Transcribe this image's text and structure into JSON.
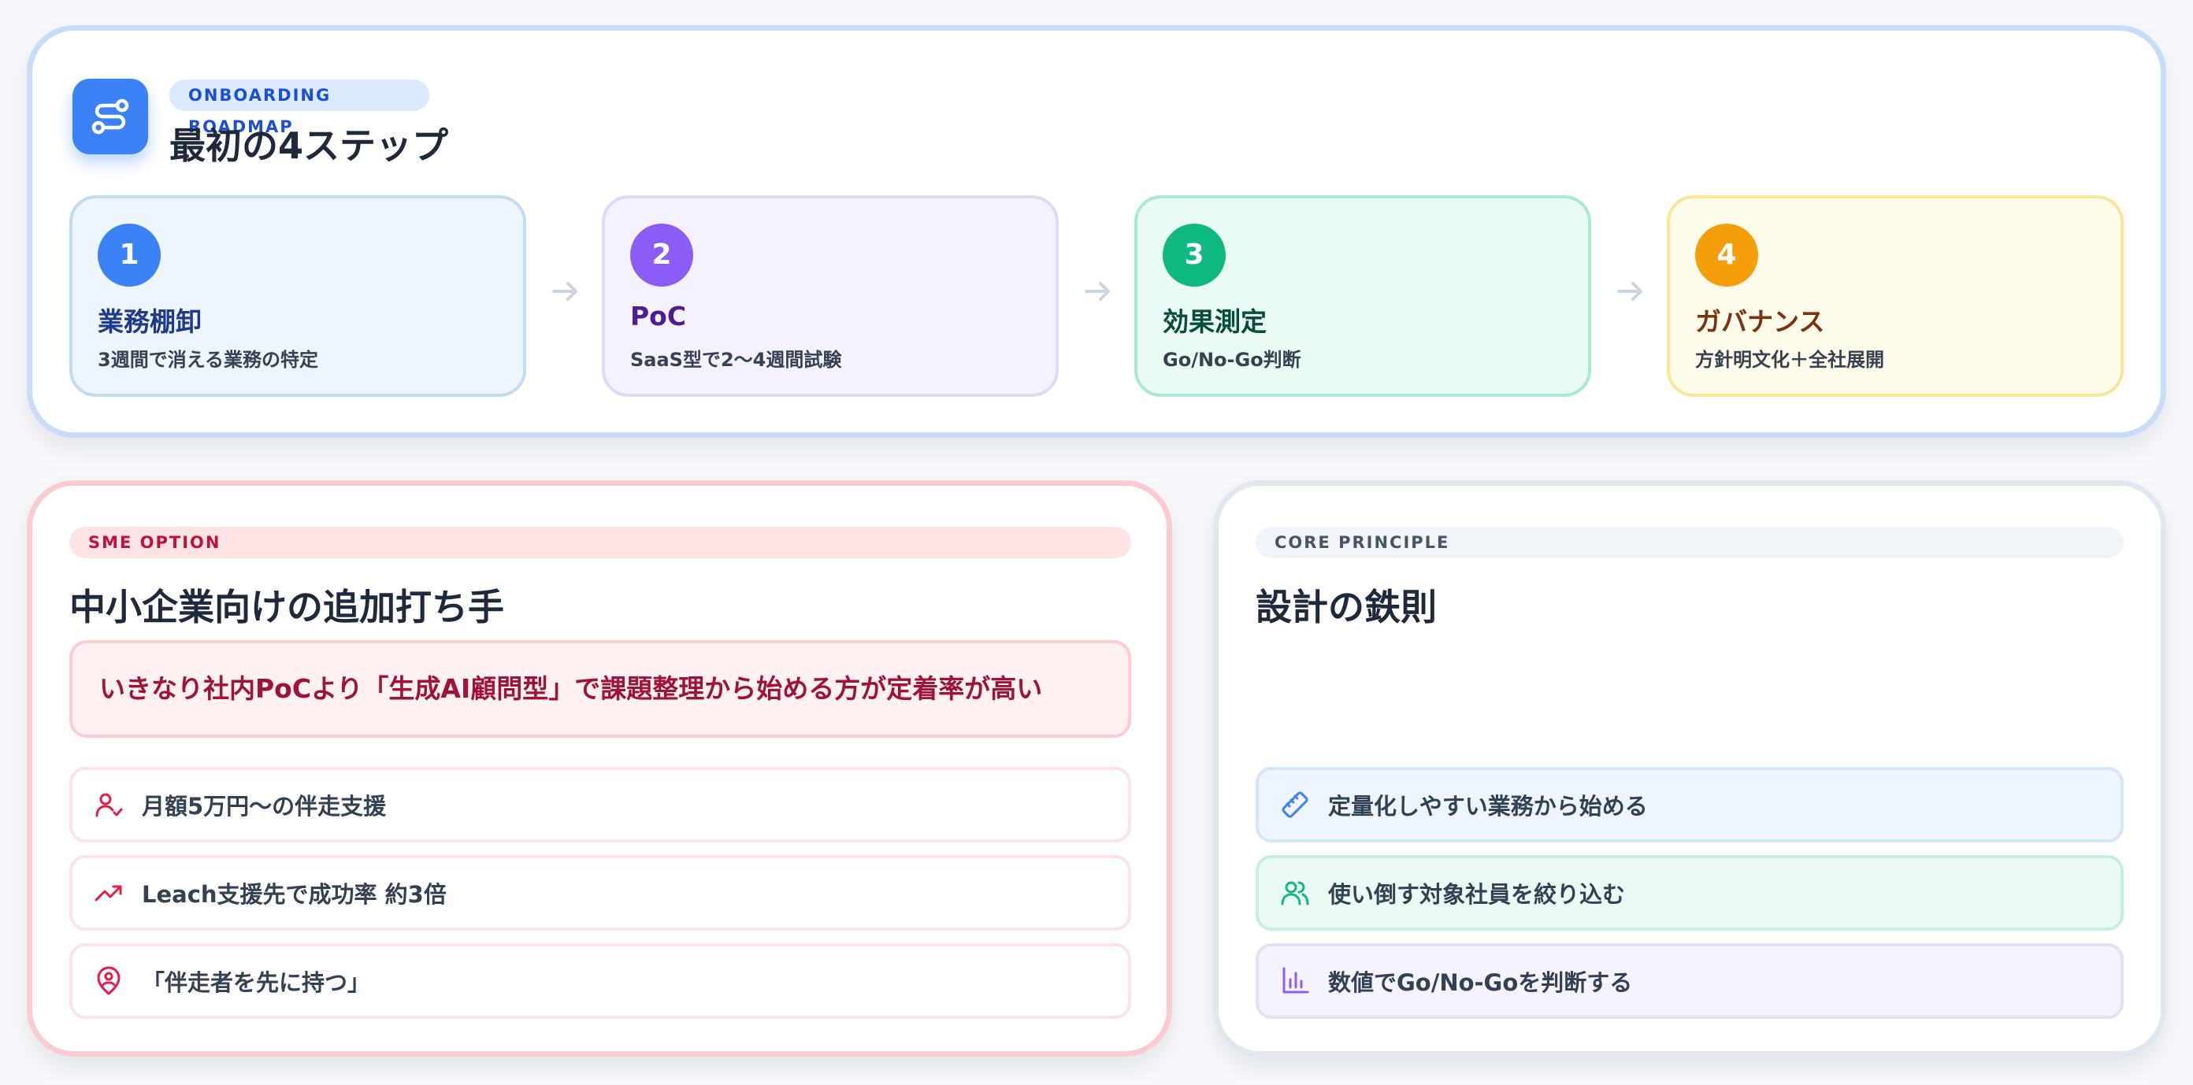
{
  "roadmap": {
    "badge": "ONBOARDING ROADMAP",
    "title": "最初の4ステップ",
    "steps": [
      {
        "num": "1",
        "title": "業務棚卸",
        "subtitle": "3週間で消える業務の特定",
        "color": "#3b82f6",
        "bg": "#eef5ff",
        "border": "#c3dcf5",
        "title_color": "#1e3a8a"
      },
      {
        "num": "2",
        "title": "PoC",
        "subtitle": "SaaS型で2〜4週間試験",
        "color": "#8b5cf6",
        "bg": "#f4f2ff",
        "border": "#dedbf7",
        "title_color": "#4c1d95"
      },
      {
        "num": "3",
        "title": "効果測定",
        "subtitle": "Go/No-Go判断",
        "color": "#10b981",
        "bg": "#eafbf3",
        "border": "#a7ecd0",
        "title_color": "#064e3b"
      },
      {
        "num": "4",
        "title": "ガバナンス",
        "subtitle": "方針明文化＋全社展開",
        "color": "#f59e0b",
        "bg": "#fffbea",
        "border": "#fbe59a",
        "title_color": "#78350f"
      }
    ]
  },
  "sme": {
    "badge": "SME OPTION",
    "title": "中小企業向けの追加打ち手",
    "highlight": "いきなり社内PoCより「生成AI顧問型」で課題整理から始める方が定着率が高い",
    "items": [
      {
        "icon": "user-check-icon",
        "text": "月額5万円〜の伴走支援"
      },
      {
        "icon": "trending-up-icon",
        "text": "Leach支援先で成功率 約3倍"
      },
      {
        "icon": "user-pin-icon",
        "text": "「伴走者を先に持つ」"
      }
    ]
  },
  "core": {
    "badge": "CORE PRINCIPLE",
    "title": "設計の鉄則",
    "items": [
      {
        "icon": "ruler-icon",
        "text": "定量化しやすい業務から始める",
        "color": "#3b82f6",
        "bg": "#eef5ff",
        "border": "#d4e6fb"
      },
      {
        "icon": "users-icon",
        "text": "使い倒す対象社員を絞り込む",
        "color": "#10b981",
        "bg": "#ebfbf3",
        "border": "#c7f0dc"
      },
      {
        "icon": "bar-chart-icon",
        "text": "数値でGo/No-Goを判断する",
        "color": "#8b5cf6",
        "bg": "#f5f3ff",
        "border": "#e4e0fa"
      }
    ]
  },
  "colors": {
    "accent": "#3b82f6",
    "sme_accent": "#e11d48"
  }
}
